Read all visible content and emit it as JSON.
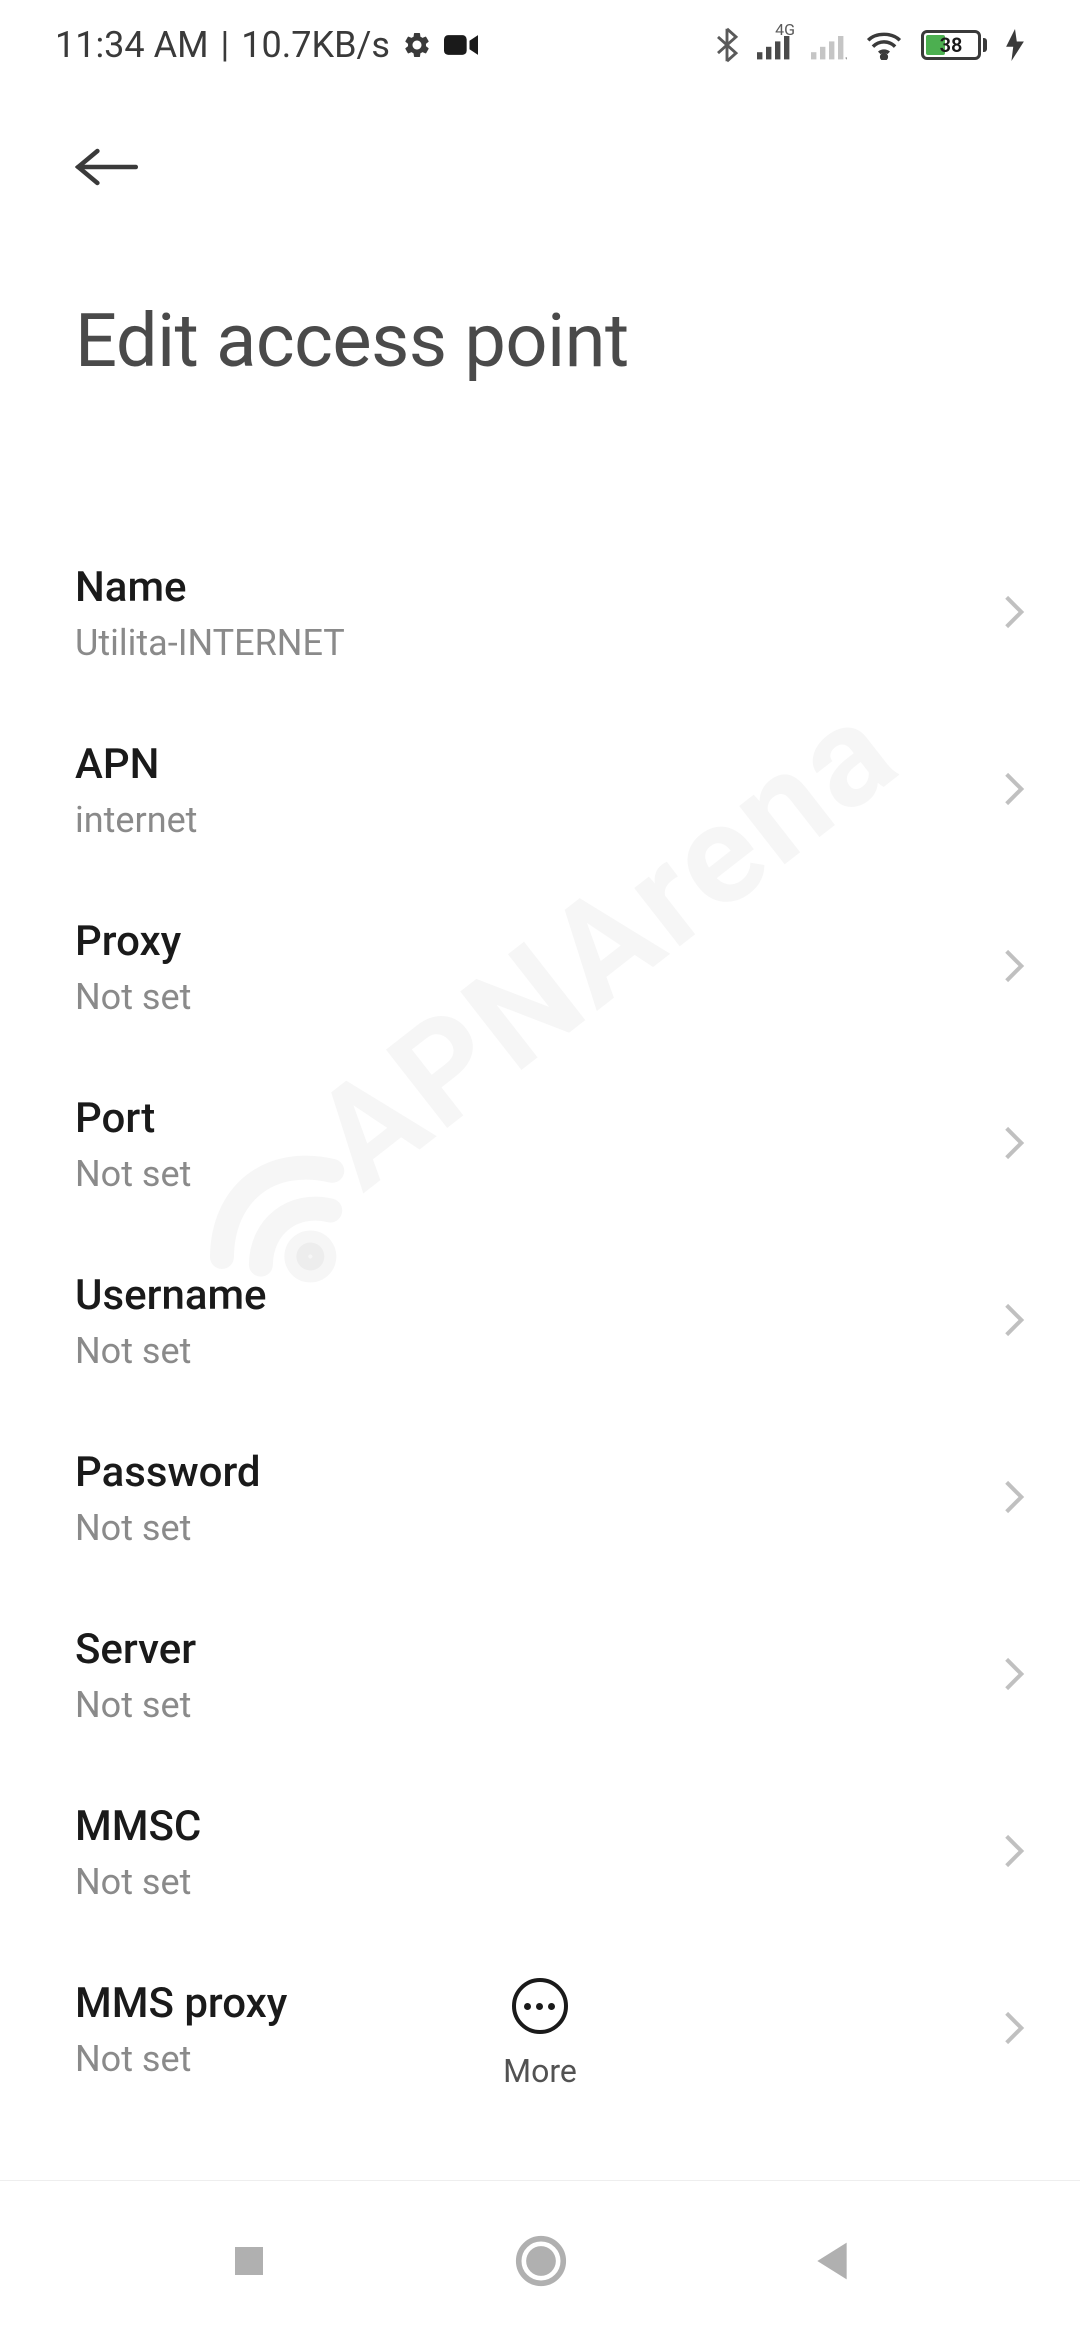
{
  "statusBar": {
    "time": "11:34 AM",
    "speed": "10.7KB/s",
    "networkTag": "4G",
    "batteryLevel": "38"
  },
  "header": {
    "title": "Edit access point"
  },
  "settings": [
    {
      "label": "Name",
      "value": "Utilita-INTERNET"
    },
    {
      "label": "APN",
      "value": "internet"
    },
    {
      "label": "Proxy",
      "value": "Not set"
    },
    {
      "label": "Port",
      "value": "Not set"
    },
    {
      "label": "Username",
      "value": "Not set"
    },
    {
      "label": "Password",
      "value": "Not set"
    },
    {
      "label": "Server",
      "value": "Not set"
    },
    {
      "label": "MMSC",
      "value": "Not set"
    },
    {
      "label": "MMS proxy",
      "value": "Not set"
    }
  ],
  "actions": {
    "moreLabel": "More"
  },
  "watermark": "APNArena"
}
